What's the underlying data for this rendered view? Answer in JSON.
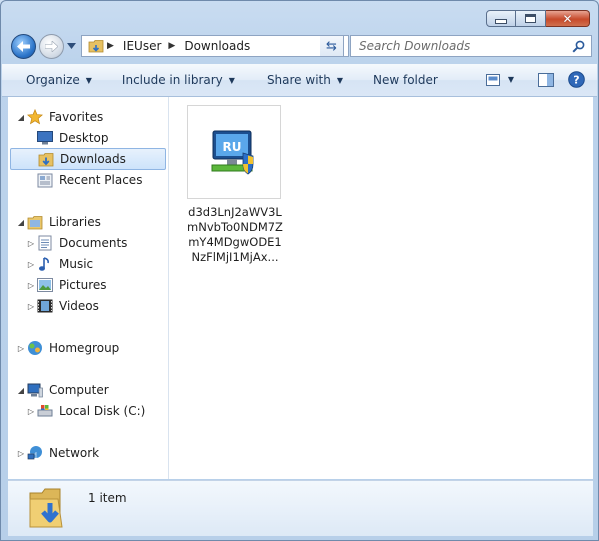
{
  "window": {
    "title": "Downloads"
  },
  "caption": {
    "minimize": "minimize",
    "maximize": "maximize",
    "close": "close"
  },
  "address": {
    "breadcrumbs": [
      "IEUser",
      "Downloads"
    ]
  },
  "search": {
    "placeholder": "Search Downloads"
  },
  "commands": [
    {
      "label": "Organize",
      "dropdown": true
    },
    {
      "label": "Include in library",
      "dropdown": true
    },
    {
      "label": "Share with",
      "dropdown": true
    },
    {
      "label": "New folder",
      "dropdown": false
    }
  ],
  "nav": {
    "favorites": {
      "label": "Favorites",
      "items": [
        "Desktop",
        "Downloads",
        "Recent Places"
      ],
      "selected": "Downloads"
    },
    "libraries": {
      "label": "Libraries",
      "items": [
        "Documents",
        "Music",
        "Pictures",
        "Videos"
      ]
    },
    "homegroup": {
      "label": "Homegroup"
    },
    "computer": {
      "label": "Computer",
      "items": [
        "Local Disk (C:)"
      ]
    },
    "network": {
      "label": "Network"
    }
  },
  "files": [
    {
      "name": "d3d3LnJ2aWV3LmNvbTo0NDM7ZmY4MDgwODE1NzFlMjI1MjAx...",
      "icon": "installer-shield-icon"
    }
  ],
  "status": {
    "count_text": "1 item"
  },
  "colors": {
    "accent": "#3c7fb1",
    "selection": "#cde3fb"
  }
}
